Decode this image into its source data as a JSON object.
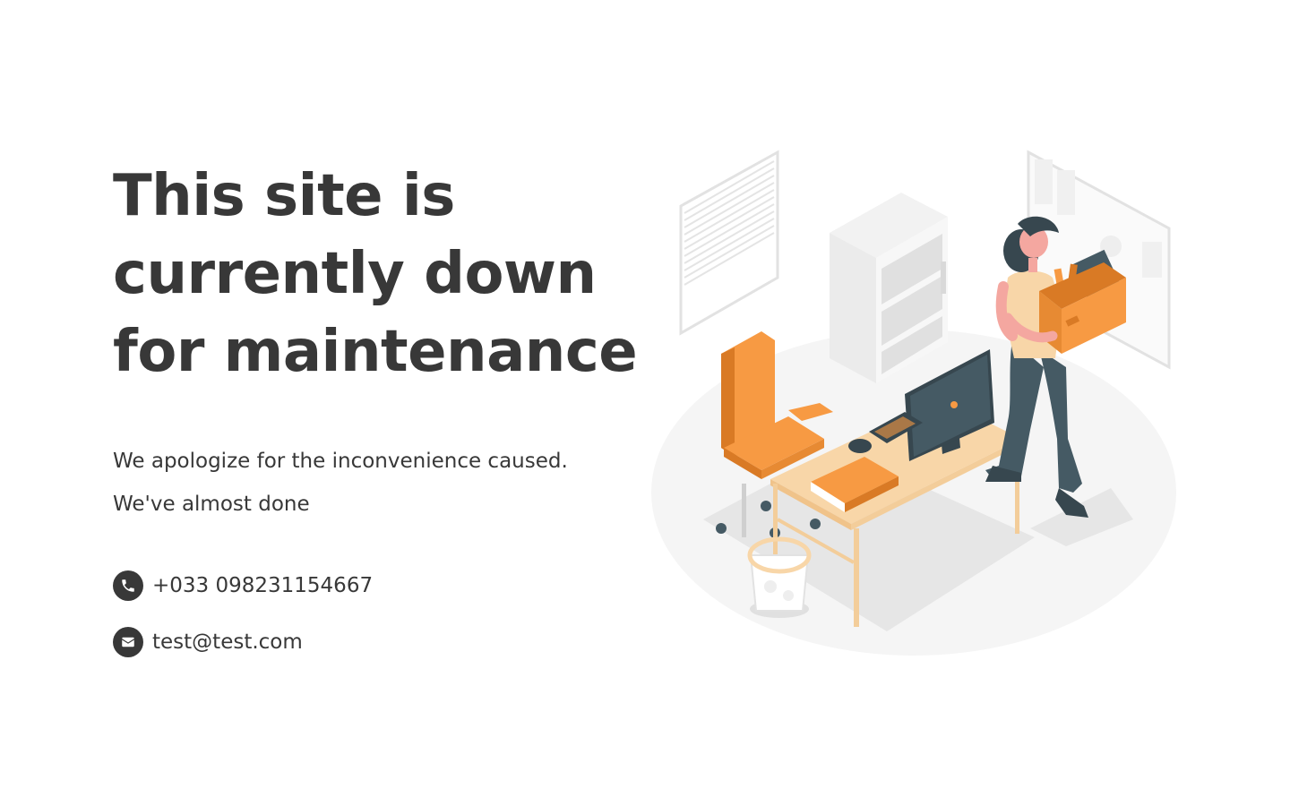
{
  "heading": {
    "line1": "This site is",
    "line2": "currently down",
    "line3": "for maintenance"
  },
  "messages": {
    "apology": "We apologize for the inconvenience caused.",
    "status": "We've almost done"
  },
  "contacts": {
    "phone": {
      "icon": "phone-icon",
      "text": "+033 098231154667"
    },
    "email": {
      "icon": "envelope-icon",
      "text": "test@test.com"
    }
  },
  "colors": {
    "text": "#383838",
    "accent": "#f79a43",
    "accent_dark": "#d97a25",
    "desk_wood": "#f8d6a8",
    "monitor": "#37474f",
    "floor": "#f5f5f5"
  },
  "illustration": {
    "icon": "office-illustration"
  }
}
